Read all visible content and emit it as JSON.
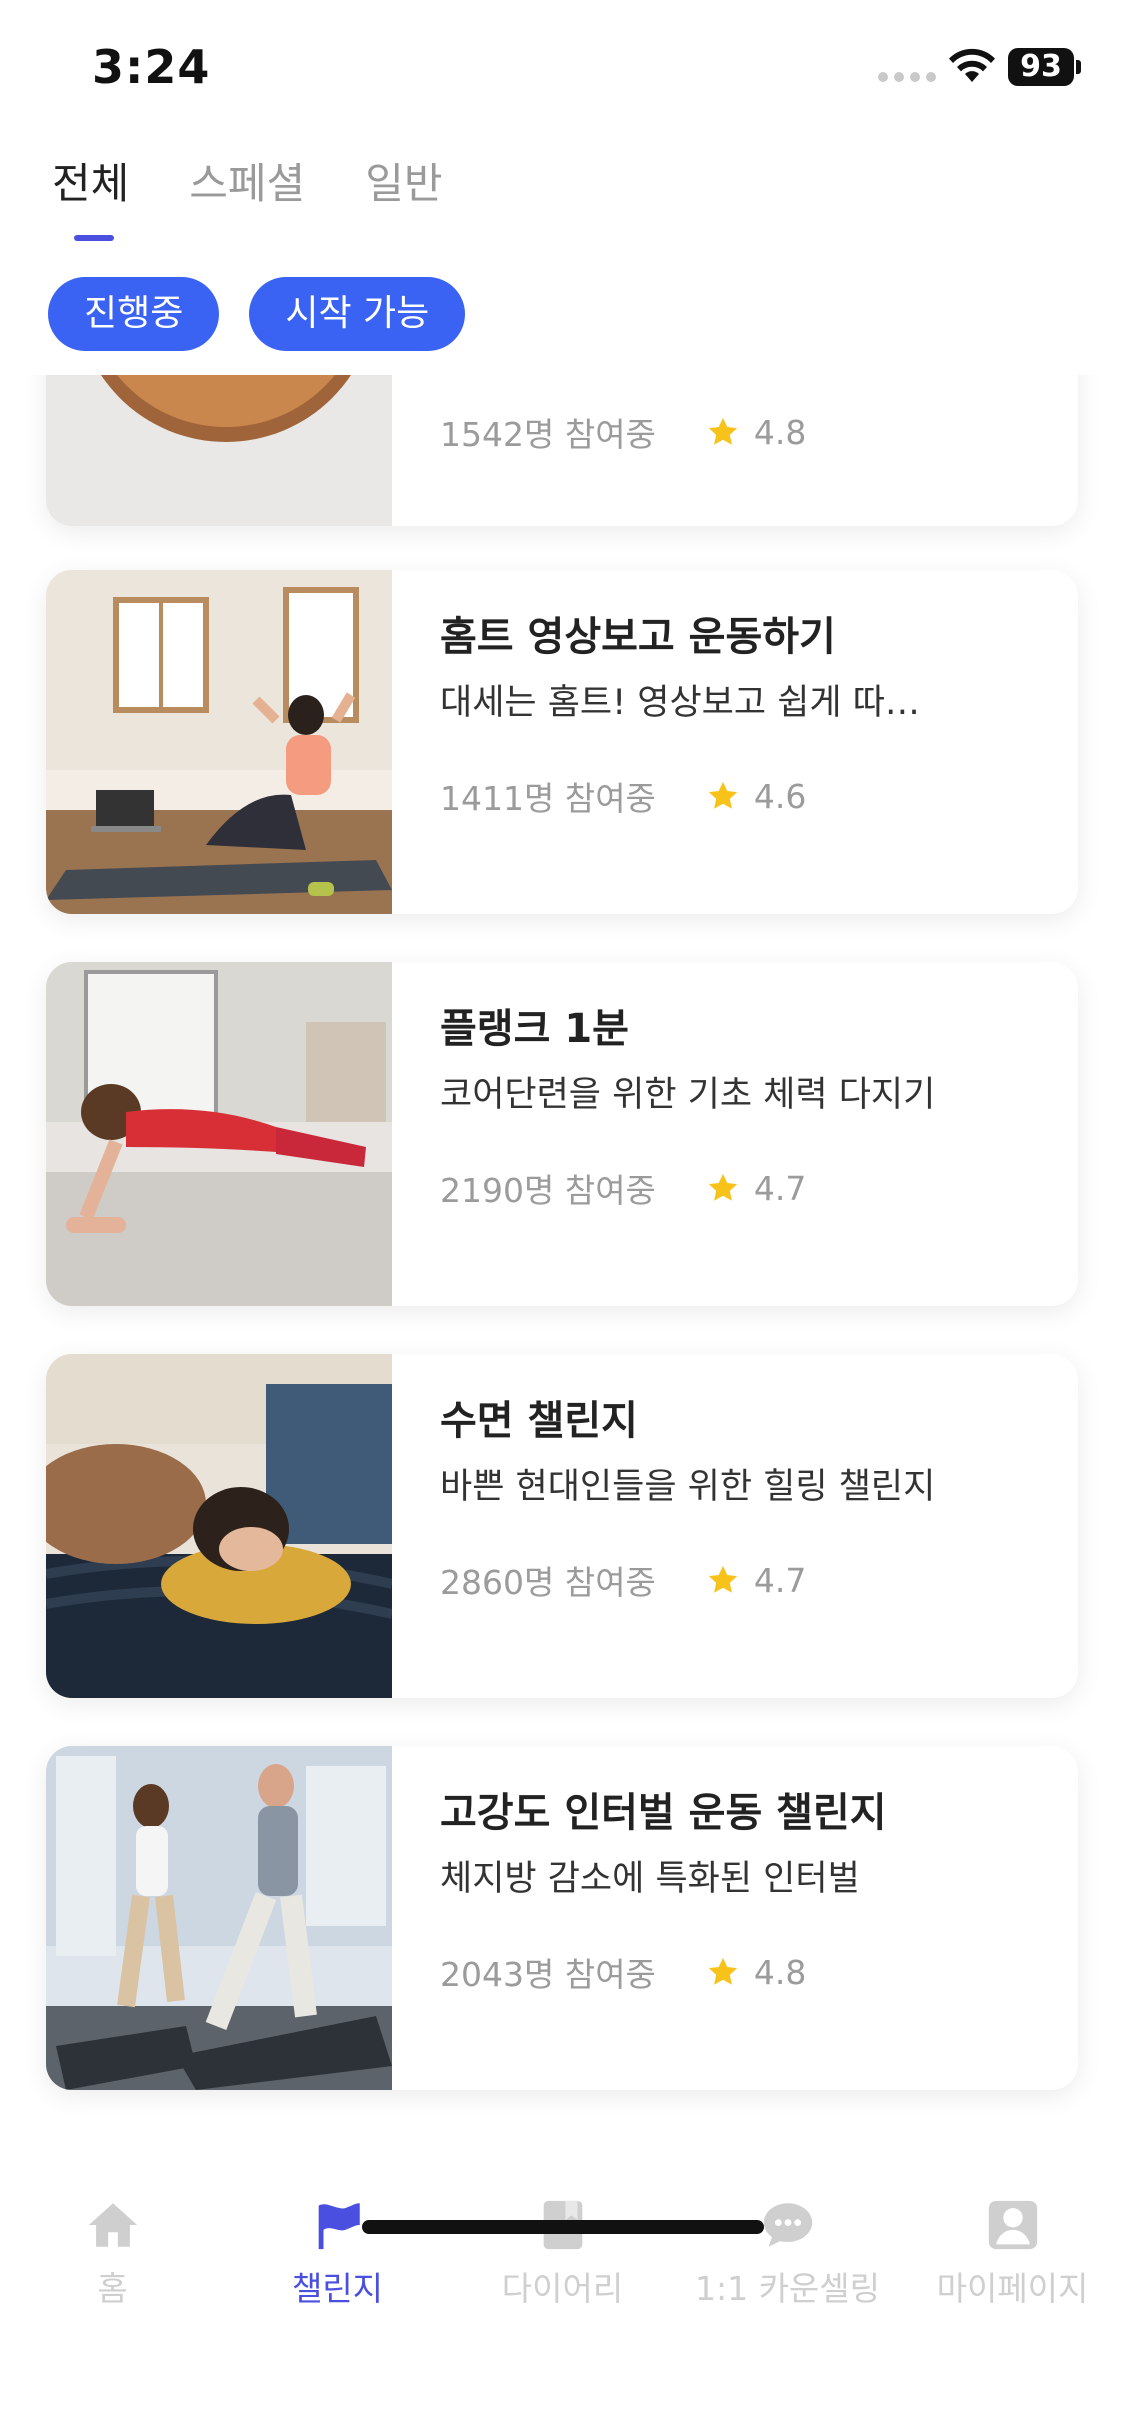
{
  "status_bar": {
    "time": "3:24",
    "battery": "93"
  },
  "tabs": [
    {
      "label": "전체",
      "active": true
    },
    {
      "label": "스페셜",
      "active": false
    },
    {
      "label": "일반",
      "active": false
    }
  ],
  "filters": [
    {
      "label": "진행중"
    },
    {
      "label": "시작 가능"
    }
  ],
  "challenges": [
    {
      "title": "",
      "description": "",
      "participants": "1542명 참여중",
      "rating": "4.8",
      "image": "salad-bowl"
    },
    {
      "title": "홈트 영상보고 운동하기",
      "description": "대세는 홈트! 영상보고 쉽게 따…",
      "participants": "1411명 참여중",
      "rating": "4.6",
      "image": "home-workout"
    },
    {
      "title": "플랭크 1분",
      "description": "코어단련을 위한 기초 체력 다지기",
      "participants": "2190명 참여중",
      "rating": "4.7",
      "image": "plank"
    },
    {
      "title": "수면 챌린지",
      "description": "바쁜 현대인들을 위한 힐링 챌린지",
      "participants": "2860명 참여중",
      "rating": "4.7",
      "image": "sleep"
    },
    {
      "title": "고강도 인터벌 운동 챌린지",
      "description": "체지방 감소에 특화된 인터벌",
      "participants": "2043명 참여중",
      "rating": "4.8",
      "image": "treadmill"
    }
  ],
  "bottom_nav": [
    {
      "label": "홈",
      "icon": "home-icon",
      "active": false
    },
    {
      "label": "챌린지",
      "icon": "flag-icon",
      "active": true
    },
    {
      "label": "다이어리",
      "icon": "diary-icon",
      "active": false
    },
    {
      "label": "1:1 카운셀링",
      "icon": "chat-icon",
      "active": false
    },
    {
      "label": "마이페이지",
      "icon": "profile-icon",
      "active": false
    }
  ],
  "colors": {
    "accent": "#4a4fe0",
    "chip": "#3b63f3",
    "star": "#f7c21a",
    "inactive": "#cfcfcf"
  }
}
